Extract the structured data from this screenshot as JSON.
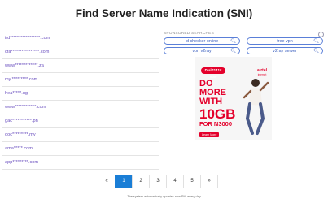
{
  "page": {
    "title": "Find Server Name Indication (SNI)"
  },
  "domains": [
    "ird*****************.com",
    "cfa****************.com",
    "www*************.za",
    "my.*********.com",
    "hea*****.ug",
    "www************.com",
    "gac***********.ph",
    "ooc*********.my",
    "ama*****.com",
    "app*********.com"
  ],
  "sponsored": {
    "label": "SPONSORED SEARCHES",
    "info_icon": "info-icon",
    "chips": [
      {
        "label": "id checker online",
        "icon": "search-icon"
      },
      {
        "label": "free vpn",
        "icon": "search-icon"
      },
      {
        "label": "vpn v2ray",
        "icon": "search-icon"
      },
      {
        "label": "v2ray server",
        "icon": "search-icon"
      }
    ]
  },
  "ad": {
    "dial": "Dial *141# now",
    "brand": "airtel",
    "brand_sub": "internet",
    "lines": [
      "DO",
      "MORE",
      "WITH",
      "10GB",
      "FOR N3000"
    ],
    "cta": "Learn More"
  },
  "pagination": {
    "prev": "«",
    "pages": [
      "1",
      "2",
      "3",
      "4",
      "5"
    ],
    "active": "1",
    "next": "»"
  },
  "footer": {
    "note": "The system automatically updates new SNI every day"
  },
  "colors": {
    "accent": "#1a7ed6",
    "link": "#6a4fbf",
    "ad_red": "#e4002b"
  }
}
